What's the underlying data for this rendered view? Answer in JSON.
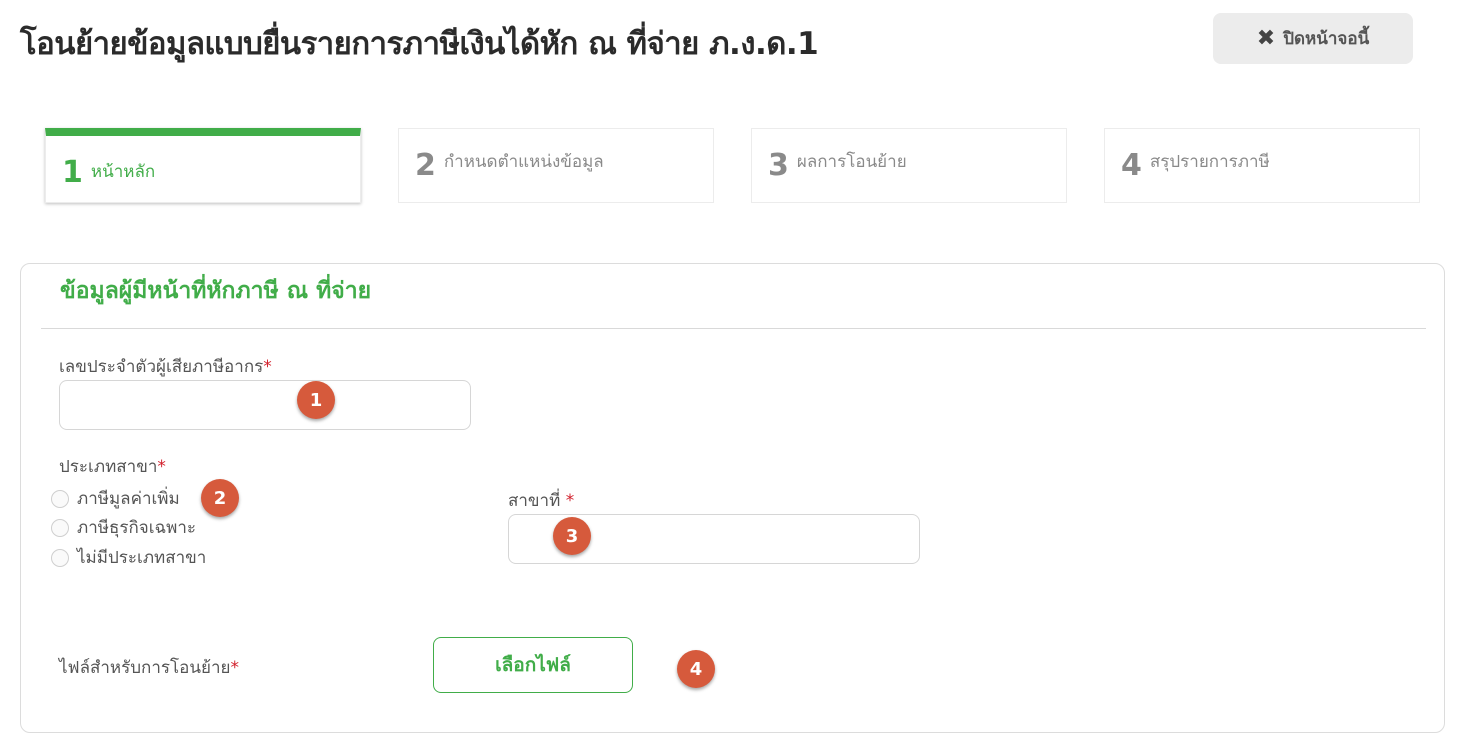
{
  "header": {
    "title": "โอนย้ายข้อมูลแบบยื่นรายการภาษีเงินได้หัก ณ ที่จ่าย ภ.ง.ด.1",
    "close_icon": "✖",
    "close_label": "ปิดหน้าจอนี้"
  },
  "steps": [
    {
      "number": "1",
      "label": "หน้าหลัก",
      "active": true
    },
    {
      "number": "2",
      "label": "กำหนดตำแหน่งข้อมูล",
      "active": false
    },
    {
      "number": "3",
      "label": "ผลการโอนย้าย",
      "active": false
    },
    {
      "number": "4",
      "label": "สรุปรายการภาษี",
      "active": false
    }
  ],
  "form": {
    "section_title": "ข้อมูลผู้มีหน้าที่หักภาษี ณ ที่จ่าย",
    "required_mark": "*",
    "tax_id": {
      "label": "เลขประจำตัวผู้เสียภาษีอากร",
      "value": ""
    },
    "branch_type": {
      "label": "ประเภทสาขา",
      "options": [
        "ภาษีมูลค่าเพิ่ม",
        "ภาษีธุรกิจเฉพาะ",
        "ไม่มีประเภทสาขา"
      ]
    },
    "branch_no": {
      "label": "สาขาที่ ",
      "value": ""
    },
    "file": {
      "label": "ไฟล์สำหรับการโอนย้าย",
      "button": "เลือกไฟล์"
    }
  },
  "markers": [
    "1",
    "2",
    "3",
    "4"
  ],
  "colors": {
    "accent": "#41ad49",
    "required": "#d21f2b",
    "marker": "#d65a3c"
  }
}
